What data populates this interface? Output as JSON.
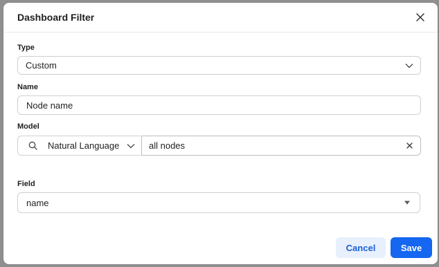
{
  "dialog": {
    "title": "Dashboard Filter"
  },
  "type": {
    "label": "Type",
    "value": "Custom"
  },
  "name": {
    "label": "Name",
    "value": "Node name"
  },
  "model": {
    "label": "Model",
    "mode": "Natural Language",
    "query": "all nodes"
  },
  "field": {
    "label": "Field",
    "value": "name"
  },
  "actions": {
    "cancel": "Cancel",
    "save": "Save"
  },
  "colors": {
    "primary": "#1566f0",
    "secondary_bg": "#e8f0fd"
  },
  "icons": {
    "close": "close-icon",
    "chevron": "chevron-down-icon",
    "search": "search-icon",
    "clear": "clear-icon",
    "caret": "caret-down-icon"
  }
}
